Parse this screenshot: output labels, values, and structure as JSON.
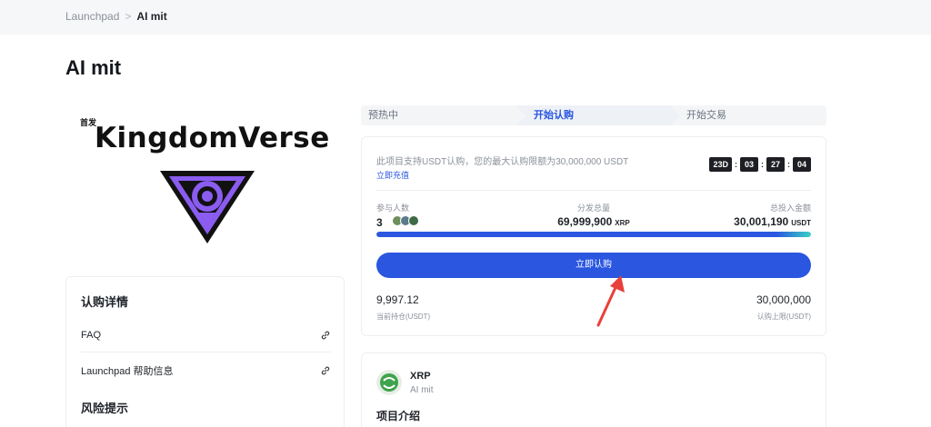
{
  "breadcrumb": {
    "parent": "Launchpad",
    "separator": ">",
    "current": "AI mit"
  },
  "page": {
    "title": "AI mit"
  },
  "logo": {
    "first_tag": "首发",
    "brand_text": "KingdomVerse"
  },
  "details": {
    "title": "认购详情",
    "rows": [
      {
        "label": "FAQ",
        "icon": "link-icon"
      },
      {
        "label": "Launchpad 帮助信息",
        "icon": "link-icon"
      }
    ],
    "risk_title": "风险提示"
  },
  "stages": [
    {
      "label": "预热中",
      "active": false
    },
    {
      "label": "开始认购",
      "active": true
    },
    {
      "label": "开始交易",
      "active": false
    }
  ],
  "subscription": {
    "description": "此项目支持USDT认购，您的最大认购限额为30,000,000 USDT",
    "recharge_link": "立即充值",
    "countdown": {
      "days": "23D",
      "hours": "03",
      "minutes": "27",
      "seconds": "04"
    },
    "participants": {
      "label": "参与人数",
      "value": "3"
    },
    "total_supply": {
      "label": "分发总量",
      "value": "69,999,900",
      "unit": "XRP"
    },
    "total_invested": {
      "label": "总投入金额",
      "value": "30,001,190",
      "unit": "USDT"
    },
    "progress_percent": 100,
    "button_label": "立即认购",
    "current_holding": {
      "value": "9,997.12",
      "label": "当前持仓(USDT)"
    },
    "subscribe_limit": {
      "value": "30,000,000",
      "label": "认购上限(USDT)"
    }
  },
  "project": {
    "token_name": "XRP",
    "token_sub": "AI mit",
    "intro_title": "项目介绍"
  },
  "colors": {
    "accent": "#2a56e0",
    "dark": "#1e1f24",
    "emblem": "#8a5cf0"
  }
}
